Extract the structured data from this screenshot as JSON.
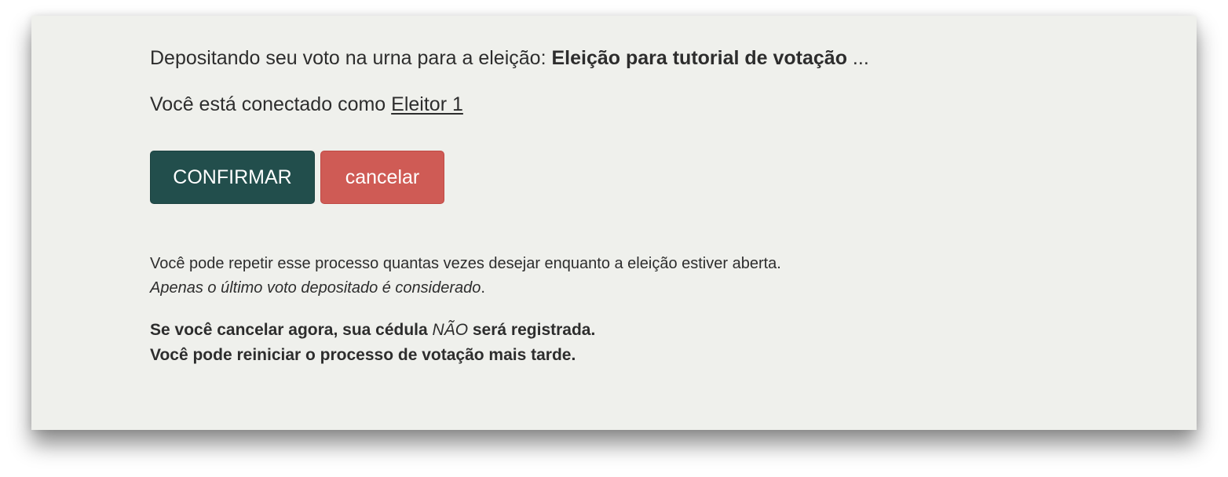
{
  "header": {
    "prefix": "Depositando seu voto na urna para a eleição: ",
    "election_name": "Eleição para tutorial de votação",
    "suffix": " ..."
  },
  "user": {
    "prefix": "Você está conectado como ",
    "name": "Eleitor 1"
  },
  "buttons": {
    "confirm_label": "CONFIRMAR",
    "cancel_label": "cancelar"
  },
  "info": {
    "line1": "Você pode repetir esse processo quantas vezes desejar enquanto a eleição estiver aberta.",
    "line2": "Apenas o último voto depositado é considerado",
    "line2_period": "."
  },
  "warning": {
    "line1_prefix": "Se você cancelar agora, sua cédula ",
    "line1_emphasis": "NÃO",
    "line1_suffix": " será registrada.",
    "line2": "Você pode reiniciar o processo de votação mais tarde."
  },
  "colors": {
    "background": "#eff0ec",
    "confirm": "#224e4c",
    "cancel": "#cf5b55",
    "text": "#2d2d2d"
  }
}
